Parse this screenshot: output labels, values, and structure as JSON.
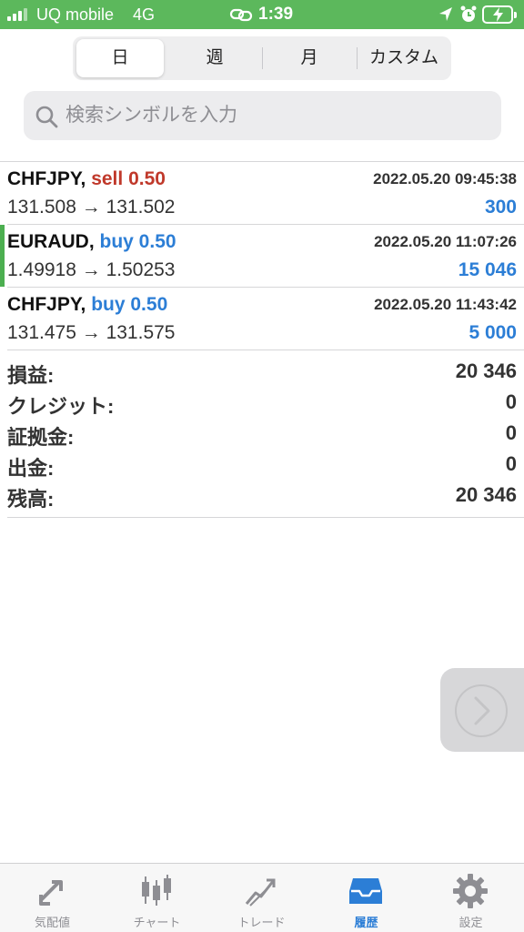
{
  "status_bar": {
    "carrier": "UQ mobile",
    "network": "4G",
    "time": "1:39"
  },
  "period_tabs": [
    {
      "label": "日",
      "active": true
    },
    {
      "label": "週",
      "active": false
    },
    {
      "label": "月",
      "active": false
    },
    {
      "label": "カスタム",
      "active": false
    }
  ],
  "search": {
    "placeholder": "検索シンボルを入力",
    "value": ""
  },
  "trades": [
    {
      "symbol": "CHFJPY,",
      "direction": "sell",
      "volume": "0.50",
      "direction_label": "sell 0.50",
      "datetime": "2022.05.20 09:45:38",
      "prices": "131.508 → 131.502",
      "profit": "300",
      "highlighted": false
    },
    {
      "symbol": "EURAUD,",
      "direction": "buy",
      "volume": "0.50",
      "direction_label": "buy 0.50",
      "datetime": "2022.05.20 11:07:26",
      "prices": "1.49918 → 1.50253",
      "profit": "15 046",
      "highlighted": true
    },
    {
      "symbol": "CHFJPY,",
      "direction": "buy",
      "volume": "0.50",
      "direction_label": "buy 0.50",
      "datetime": "2022.05.20 11:43:42",
      "prices": "131.475 → 131.575",
      "profit": "5 000",
      "highlighted": false
    }
  ],
  "summary": [
    {
      "label": "損益:",
      "value": "20 346"
    },
    {
      "label": "クレジット:",
      "value": "0"
    },
    {
      "label": "証拠金:",
      "value": "0"
    },
    {
      "label": "出金:",
      "value": "0"
    },
    {
      "label": "残高:",
      "value": "20 346"
    }
  ],
  "tab_bar": [
    {
      "label": "気配値",
      "icon": "quotes-icon",
      "active": false
    },
    {
      "label": "チャート",
      "icon": "chart-icon",
      "active": false
    },
    {
      "label": "トレード",
      "icon": "trade-icon",
      "active": false
    },
    {
      "label": "履歴",
      "icon": "history-icon",
      "active": true
    },
    {
      "label": "設定",
      "icon": "settings-icon",
      "active": false
    }
  ],
  "colors": {
    "status_bar": "#5cb85c",
    "sell": "#c0392b",
    "buy": "#2c7ed6",
    "profit": "#2c7ed6",
    "accent_bar": "#4caf50",
    "tab_active": "#2c7ed6",
    "tab_inactive": "#8e8e93"
  }
}
